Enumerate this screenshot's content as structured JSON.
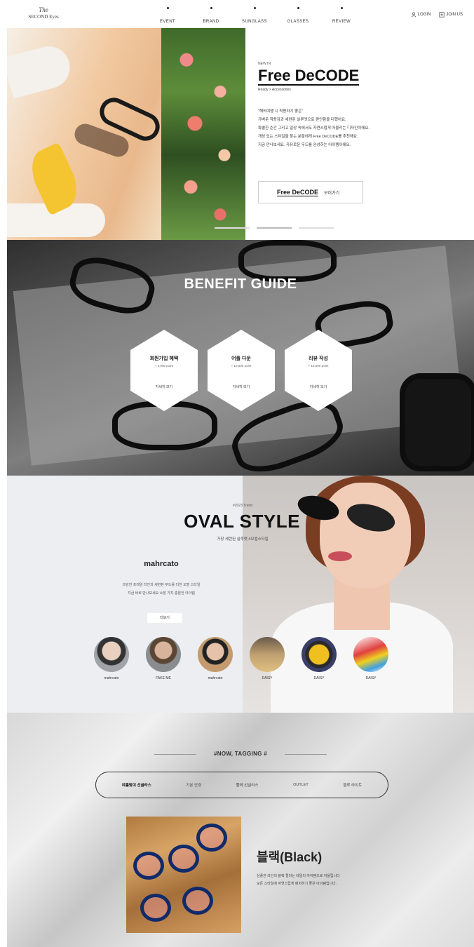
{
  "header": {
    "logo_line1": "The",
    "logo_line2": "SECOND Eyes",
    "nav": [
      "EVENT",
      "BRAND",
      "SUNGLASS",
      "GLASSES",
      "REVIEW"
    ],
    "login": "LOGIN",
    "join": "JOIN US"
  },
  "hero": {
    "eyebrow": "NEW IN",
    "title": "Free DeCODE",
    "subtitle": "Ready > Accessories",
    "desc": [
      "\"해외여행 시 착용하기 좋은\"",
      "가벼운 착용감과 세련된 실루엣으로 편안함을 더했어요.",
      "특별한 순간 그리고 일상 속에서도 자연스럽게 어울리는 디자인이에요.",
      "개성 있는 스타일을 찾는 분들에게 Free DeCODE를 추천해요.",
      "지금 만나보세요. 자유로운 무드를 완성하는 아이템이에요."
    ],
    "button_brand": "Free DeCODE",
    "button_label": "보러가기",
    "slides": 3,
    "active_slide": 1
  },
  "benefit": {
    "title": "BENEFIT GUIDE",
    "cards": [
      {
        "title": "회원가입 혜택",
        "sub": "+ 3,000 point",
        "link": "자세히 보기"
      },
      {
        "title": "어플 다운",
        "sub": "+ 10,000 point",
        "link": "자세히 보기"
      },
      {
        "title": "리뷰 작성",
        "sub": "+ 10,000 point",
        "link": "자세히 보기"
      }
    ]
  },
  "oval": {
    "sub": "#2023 Trend",
    "title": "OVAL STYLE",
    "tag": "가장 세련된 실루엣 #오벌스타일",
    "name": "mahrcato",
    "desc": [
      "과감한 프레임 라인과 세련된 무드를 더한 오벌 스타일",
      "지금 바로 만나보세요 소장 가치 충분한 아이템"
    ],
    "button": "더보기",
    "avatars": [
      "mahrcato",
      "FAKE ME",
      "mahrcato",
      "DAISY",
      "DAISY",
      "DAISY"
    ]
  },
  "tagging": {
    "title": "#NOW, TAGGING #",
    "tabs": [
      "여름맞이 선글라스",
      "기본 안경",
      "뿔테 선글라스",
      "OUTLET",
      "블루 라이트"
    ],
    "active_tab": 0,
    "product_name": "블랙(Black)",
    "product_desc": [
      "심플한 라인의 블랙 컬러는 데일리 아이템으로 어울립니다",
      "모든 스타일에 자연스럽게 매치하기 좋은 아이템입니다."
    ]
  },
  "colors": {
    "accent": "#111111",
    "benefit_bg": "#6d6d6d",
    "oval_bg": "#edeef2",
    "frame_blue": "#102a6a"
  }
}
